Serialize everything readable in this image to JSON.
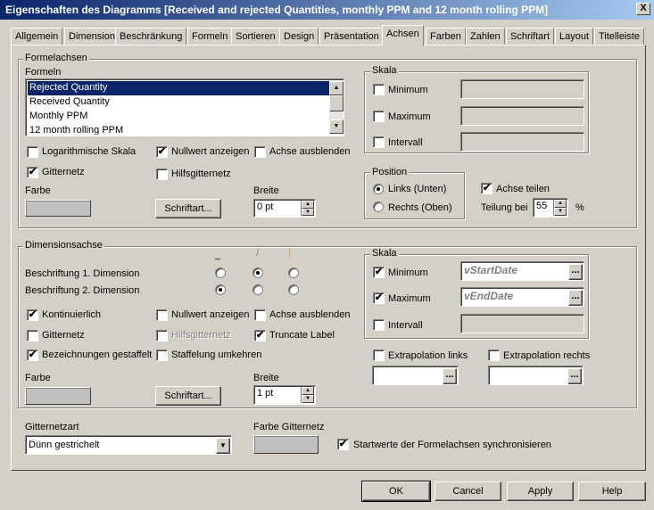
{
  "window": {
    "title": "Eigenschaften des Diagramms [Received and rejected Quantities, monthly PPM and 12 month rolling PPM]",
    "close": "X"
  },
  "tabs": [
    "Allgemein",
    "Dimension",
    "Beschränkung",
    "Formeln",
    "Sortieren",
    "Design",
    "Präsentation",
    "Achsen",
    "Farben",
    "Zahlen",
    "Schriftart",
    "Layout",
    "Titelleiste"
  ],
  "formula_axes": {
    "legend": "Formelachsen",
    "formulas_label": "Formeln",
    "formulas": [
      "Rejected Quantity",
      "Received Quantity",
      "Monthly PPM",
      "12 month rolling PPM"
    ],
    "log_scale": "Logarithmische Skala",
    "show_zero": "Nullwert anzeigen",
    "hide_axis": "Achse ausblenden",
    "grid": "Gitternetz",
    "minor_grid": "Hilfsgitternetz",
    "color_label": "Farbe",
    "font_button": "Schriftart...",
    "width_label": "Breite",
    "width_value": "0 pt",
    "scale": {
      "legend": "Skala",
      "minimum": "Minimum",
      "maximum": "Maximum",
      "interval": "Intervall"
    },
    "position": {
      "legend": "Position",
      "left": "Links (Unten)",
      "right": "Rechts (Oben)"
    },
    "split_axis": "Achse teilen",
    "split_at_label": "Teilung bei",
    "split_at_value": "55",
    "percent": "%"
  },
  "dimension_axis": {
    "legend": "Dimensionsachse",
    "orient_symbols": [
      "_",
      "/",
      "|"
    ],
    "label_dim1": "Beschriftung 1. Dimension",
    "label_dim2": "Beschriftung 2. Dimension",
    "continuous": "Kontinuierlich",
    "show_zero": "Nullwert anzeigen",
    "hide_axis": "Achse ausblenden",
    "grid": "Gitternetz",
    "minor_grid": "Hilfsgitternetz",
    "truncate": "Truncate Label",
    "staggered": "Bezeichnungen gestaffelt",
    "reverse_stagger": "Staffelung umkehren",
    "color_label": "Farbe",
    "font_button": "Schriftart...",
    "width_label": "Breite",
    "width_value": "1 pt",
    "scale": {
      "legend": "Skala",
      "minimum": "Minimum",
      "minimum_value": "vStartDate",
      "maximum": "Maximum",
      "maximum_value": "vEndDate",
      "interval": "Intervall",
      "ellipsis": "..."
    },
    "extrap_left": "Extrapolation links",
    "extrap_right": "Extrapolation rechts"
  },
  "grid_type_label": "Gitternetzart",
  "grid_type_value": "Dünn gestrichelt",
  "grid_color_label": "Farbe Gitternetz",
  "sync_label": "Startwerte der Formelachsen synchronisieren",
  "buttons": {
    "ok": "OK",
    "cancel": "Cancel",
    "apply": "Apply",
    "help": "Help"
  },
  "checkmark": "✔"
}
